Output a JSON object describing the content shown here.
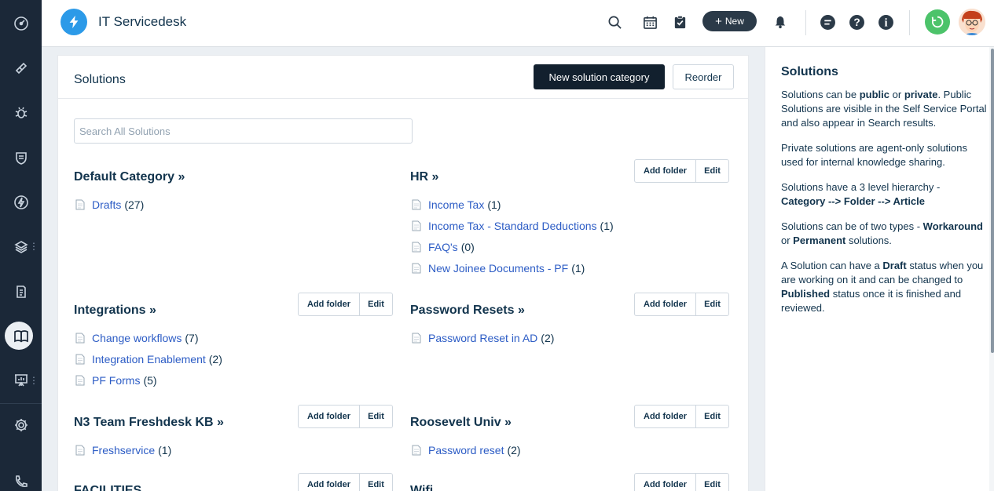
{
  "header": {
    "app_title": "IT Servicedesk",
    "new_label": "New",
    "icons": [
      "search-icon",
      "calendar-icon",
      "todo-icon",
      "bell-icon",
      "chat-icon",
      "help-icon",
      "info-icon"
    ]
  },
  "sidebar": {
    "items": [
      "dashboard-icon",
      "tickets-icon",
      "problems-icon",
      "changes-icon",
      "releases-icon",
      "assets-icon",
      "contracts-icon",
      "solutions-icon",
      "reports-icon",
      "admin-icon",
      "phone-icon"
    ],
    "active": "solutions-icon"
  },
  "main": {
    "title": "Solutions",
    "new_category_label": "New solution category",
    "reorder_label": "Reorder",
    "search_placeholder": "Search All Solutions",
    "add_folder_label": "Add folder",
    "edit_label": "Edit",
    "categories": [
      {
        "title": "Default Category »",
        "buttons": false,
        "folders": [
          {
            "name": "Drafts",
            "count": "(27)"
          }
        ]
      },
      {
        "title": "HR »",
        "buttons": true,
        "folders": [
          {
            "name": "Income Tax",
            "count": "(1)"
          },
          {
            "name": "Income Tax - Standard Deductions",
            "count": "(1)"
          },
          {
            "name": "FAQ's",
            "count": "(0)"
          },
          {
            "name": "New Joinee Documents - PF",
            "count": "(1)"
          }
        ]
      },
      {
        "title": "Integrations »",
        "buttons": true,
        "folders": [
          {
            "name": "Change workflows",
            "count": "(7)"
          },
          {
            "name": "Integration Enablement",
            "count": "(2)"
          },
          {
            "name": "PF Forms",
            "count": "(5)"
          }
        ]
      },
      {
        "title": "Password Resets »",
        "buttons": true,
        "folders": [
          {
            "name": "Password Reset in AD",
            "count": "(2)"
          }
        ]
      },
      {
        "title": "N3 Team Freshdesk KB »",
        "buttons": true,
        "folders": [
          {
            "name": "Freshservice",
            "count": "(1)"
          }
        ]
      },
      {
        "title": "Roosevelt Univ »",
        "buttons": true,
        "folders": [
          {
            "name": "Password reset",
            "count": "(2)"
          }
        ]
      },
      {
        "title": "FACILITIES",
        "buttons": true,
        "folders": []
      },
      {
        "title": "Wifi",
        "buttons": true,
        "folders": []
      }
    ]
  },
  "panel": {
    "title": "Solutions",
    "p1": {
      "t1": "Solutions can be ",
      "b1": "public",
      "t2": " or ",
      "b2": "private",
      "t3": ". Public Solutions are visible in the Self Service Portal and also appear in Search results."
    },
    "p2": "Private solutions are agent-only solutions used for internal knowledge sharing.",
    "p3": {
      "t1": "Solutions have a 3 level hierarchy - ",
      "b1": "Category --> Folder --> Article"
    },
    "p4": {
      "t1": "Solutions can be of two types - ",
      "b1": "Workaround",
      "t2": " or ",
      "b2": "Permanent",
      "t3": " solutions."
    },
    "p5": {
      "t1": "A Solution can have a ",
      "b1": "Draft",
      "t2": " status when you are working on it and can be changed to ",
      "b2": "Published",
      "t3": " status once it is finished and reviewed."
    }
  },
  "colors": {
    "nav_bg": "#1b2838",
    "link": "#2c5cc5",
    "primary_btn": "#12202e",
    "logo": "#2c9ae8",
    "online": "#4cc36a"
  }
}
